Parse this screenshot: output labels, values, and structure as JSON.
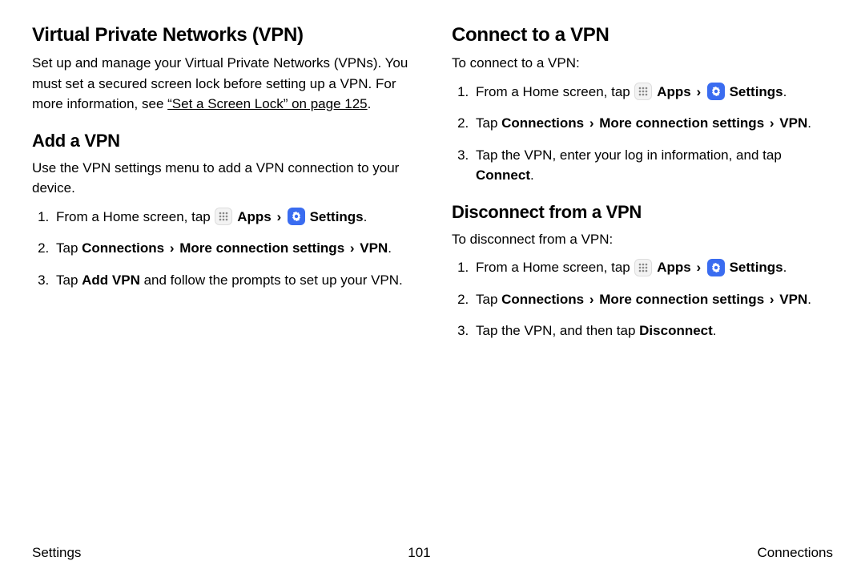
{
  "left": {
    "h1": "Virtual Private Networks (VPN)",
    "intro_a": "Set up and manage your Virtual Private Networks (VPNs). You must set a secured screen lock before setting up a VPN. For more information, see ",
    "intro_link": "“Set a Screen Lock” on page 125",
    "intro_b": ".",
    "h2": "Add a VPN",
    "add_intro": "Use the VPN settings menu to add a VPN connection to your device.",
    "steps": {
      "s1_pre": "From a Home screen, tap ",
      "s1_apps": "Apps",
      "s1_settings": "Settings",
      "s1_post": ".",
      "s2_pre": "Tap ",
      "s2_path1": "Connections",
      "s2_path2": "More connection settings",
      "s2_path3": "VPN",
      "s2_post": ".",
      "s3_pre": "Tap ",
      "s3_bold": "Add VPN",
      "s3_post": " and follow the prompts to set up your VPN."
    }
  },
  "right": {
    "h1": "Connect to a VPN",
    "connect_intro": "To connect to a VPN:",
    "conn": {
      "s1_pre": "From a Home screen, tap ",
      "s1_apps": "Apps",
      "s1_settings": "Settings",
      "s1_post": ".",
      "s2_pre": "Tap ",
      "s2_path1": "Connections",
      "s2_path2": "More connection settings",
      "s2_path3": "VPN",
      "s2_post": ".",
      "s3_a": "Tap the VPN, enter your log in information, and tap ",
      "s3_bold": "Connect",
      "s3_b": "."
    },
    "h2": "Disconnect from a VPN",
    "disc_intro": "To disconnect from a VPN:",
    "disc": {
      "s1_pre": "From a Home screen, tap ",
      "s1_apps": "Apps",
      "s1_settings": "Settings",
      "s1_post": ".",
      "s2_pre": "Tap ",
      "s2_path1": "Connections",
      "s2_path2": "More connection settings",
      "s2_path3": "VPN",
      "s2_post": ".",
      "s3_a": "Tap the VPN, and then tap ",
      "s3_bold": "Disconnect",
      "s3_b": "."
    }
  },
  "footer": {
    "left": "Settings",
    "center": "101",
    "right": "Connections"
  },
  "glyphs": {
    "chev": "›"
  }
}
